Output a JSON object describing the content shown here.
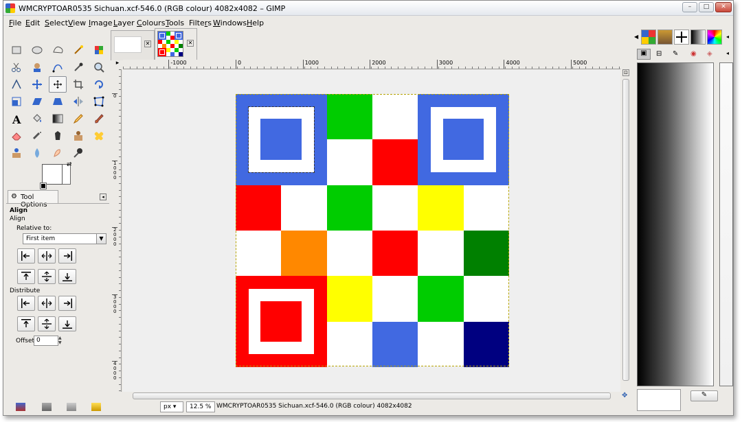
{
  "window": {
    "title": "WMCRYPTOAR0535 Sichuan.xcf-546.0 (RGB colour) 4082x4082 – GIMP",
    "controls": {
      "minimize": "–",
      "maximize": "□",
      "close": "✕"
    }
  },
  "menu": [
    {
      "label": "File",
      "key": "F"
    },
    {
      "label": "Edit",
      "key": "E"
    },
    {
      "label": "Select",
      "key": "S"
    },
    {
      "label": "View",
      "key": "V"
    },
    {
      "label": "Image",
      "key": "I"
    },
    {
      "label": "Layer",
      "key": "L"
    },
    {
      "label": "Colours",
      "key": "C"
    },
    {
      "label": "Tools",
      "key": "T"
    },
    {
      "label": "Filters",
      "key": "r"
    },
    {
      "label": "Windows",
      "key": "W"
    },
    {
      "label": "Help",
      "key": "H"
    }
  ],
  "tools": [
    "rect-select",
    "ellipse-select",
    "free-select",
    "fuzzy-select",
    "select-by-color",
    "scissors-select",
    "foreground-select",
    "paths",
    "color-picker",
    "zoom",
    "measure",
    "move",
    "align",
    "crop",
    "rotate",
    "scale",
    "shear",
    "perspective",
    "flip",
    "cage-transform",
    "text",
    "bucket-fill",
    "blend",
    "pencil",
    "paintbrush",
    "eraser",
    "airbrush",
    "ink",
    "clone",
    "heal",
    "perspective-clone",
    "blur",
    "smudge",
    "dodge-burn"
  ],
  "tool_options": {
    "tab_label": "Tool Options",
    "title": "Align",
    "subtitle": "Align",
    "relative_to_label": "Relative to:",
    "relative_to_value": "First item",
    "distribute_label": "Distribute",
    "offset_label": "Offset:",
    "offset_value": "0"
  },
  "ruler_h_labels": [
    "-1000",
    "0",
    "1000",
    "2000",
    "3000",
    "4000",
    "5000"
  ],
  "ruler_v_labels": [
    "0",
    "1000",
    "2000",
    "3000",
    "4000"
  ],
  "qr_grid": {
    "colors": {
      "B": "#4169e1",
      "R": "#ff0000",
      "G": "#00cc00",
      "Y": "#ffff00",
      "O": "#ff8800",
      "D": "#008000",
      "N": "#000080",
      "W": "#ffffff"
    },
    "cells": [
      [
        "X",
        "X",
        "G",
        "W",
        "X",
        "X"
      ],
      [
        "X",
        "X",
        "W",
        "R",
        "X",
        "X"
      ],
      [
        "R",
        "W",
        "G",
        "W",
        "Y",
        "W"
      ],
      [
        "W",
        "O",
        "W",
        "R",
        "W",
        "D"
      ],
      [
        "X",
        "X",
        "Y",
        "W",
        "G",
        "W"
      ],
      [
        "X",
        "X",
        "W",
        "B",
        "W",
        "N"
      ]
    ],
    "finders": [
      {
        "pos": "top-left",
        "color": "#4169e1"
      },
      {
        "pos": "top-right",
        "color": "#4169e1"
      },
      {
        "pos": "bottom-left",
        "color": "#ff0000"
      }
    ]
  },
  "status": {
    "unit": "px",
    "zoom": "12.5 %",
    "info": "WMCRYPTOAR0535 Sichuan.xcf-546.0 (RGB colour) 4082x4082"
  }
}
